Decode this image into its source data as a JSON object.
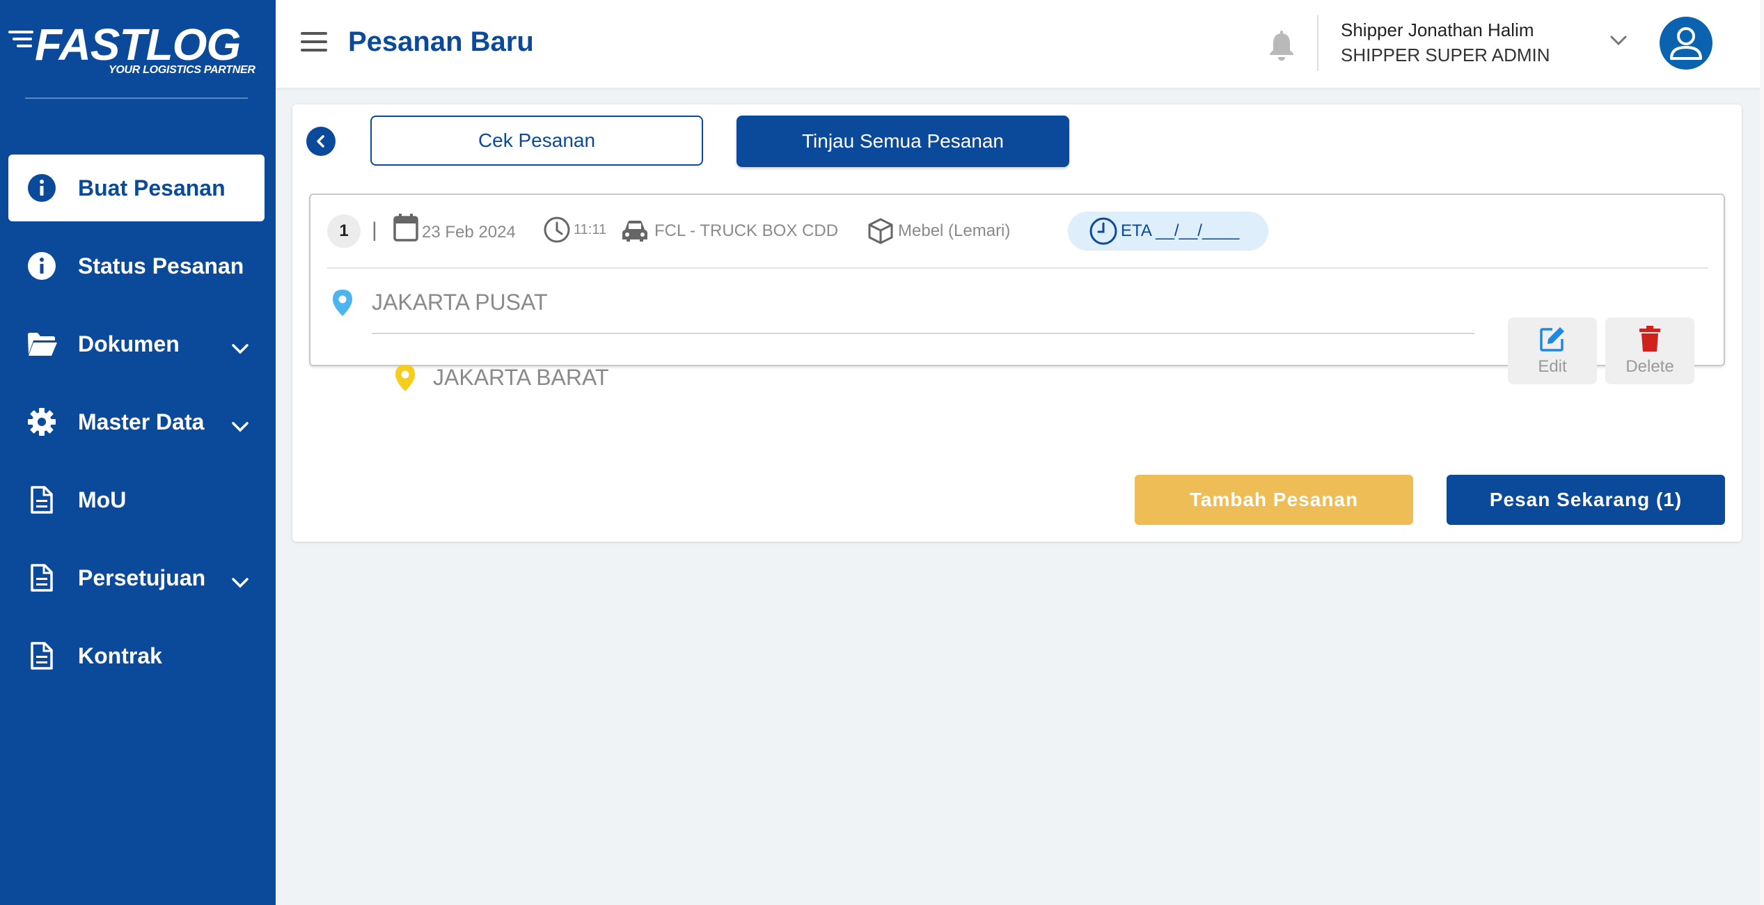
{
  "app": {
    "logo_text": "FASTLOG",
    "logo_tagline": "YOUR LOGISTICS PARTNER"
  },
  "sidebar": {
    "items": [
      {
        "label": "Buat Pesanan",
        "icon": "info-icon",
        "active": true,
        "has_submenu": false
      },
      {
        "label": "Status Pesanan",
        "icon": "info-icon",
        "active": false,
        "has_submenu": false
      },
      {
        "label": "Dokumen",
        "icon": "folder-icon",
        "active": false,
        "has_submenu": true
      },
      {
        "label": "Master Data",
        "icon": "gear-icon",
        "active": false,
        "has_submenu": true
      },
      {
        "label": "MoU",
        "icon": "document-icon",
        "active": false,
        "has_submenu": false
      },
      {
        "label": "Persetujuan",
        "icon": "document-icon",
        "active": false,
        "has_submenu": true
      },
      {
        "label": "Kontrak",
        "icon": "document-icon",
        "active": false,
        "has_submenu": false
      }
    ]
  },
  "header": {
    "title": "Pesanan Baru",
    "user_name": "Shipper Jonathan Halim",
    "user_role": "SHIPPER SUPER ADMIN"
  },
  "toolbar": {
    "cek_label": "Cek Pesanan",
    "tinjau_label": "Tinjau Semua Pesanan"
  },
  "order": {
    "number": "1",
    "separator": "|",
    "date": "23 Feb 2024",
    "time": "11:11",
    "vehicle": "FCL - TRUCK BOX CDD",
    "cargo": "Mebel (Lemari)",
    "eta": "ETA __/__/____",
    "origin": "JAKARTA PUSAT",
    "destination": "JAKARTA BARAT",
    "edit_label": "Edit",
    "delete_label": "Delete"
  },
  "actions": {
    "tambah_label": "Tambah Pesanan",
    "pesan_label": "Pesan Sekarang (1)"
  },
  "colors": {
    "brand": "#0b4a9a",
    "accent_yellow": "#efbd56",
    "delete_red": "#d0211c",
    "edit_blue": "#1e88e5"
  }
}
